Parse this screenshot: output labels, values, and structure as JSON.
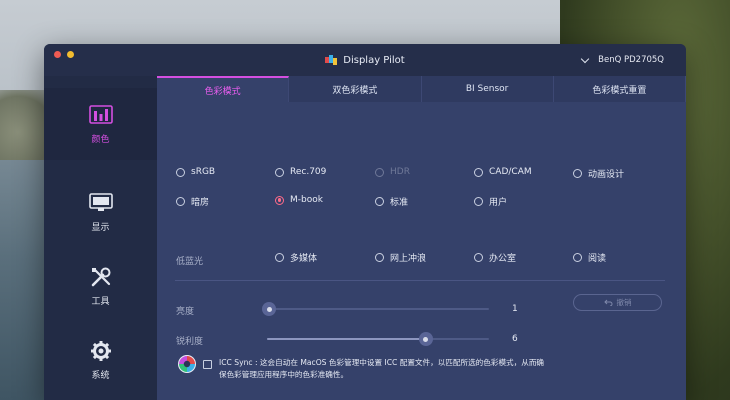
{
  "app": {
    "title": "Display Pilot",
    "monitor": "BenQ PD2705Q"
  },
  "sidebar": {
    "items": [
      {
        "label": "颜色",
        "icon": "color-bars-icon",
        "active": true
      },
      {
        "label": "显示",
        "icon": "monitor-icon",
        "active": false
      },
      {
        "label": "工具",
        "icon": "tools-icon",
        "active": false
      },
      {
        "label": "系统",
        "icon": "gear-icon",
        "active": false
      }
    ]
  },
  "tabs": [
    {
      "label": "色彩模式",
      "active": true
    },
    {
      "label": "双色彩模式",
      "active": false
    },
    {
      "label": "BI Sensor",
      "active": false
    },
    {
      "label": "色彩模式重置",
      "active": false
    }
  ],
  "color_modes": {
    "row1": [
      "sRGB",
      "Rec.709",
      "HDR",
      "CAD/CAM",
      "动画设计"
    ],
    "row2": [
      "暗房",
      "M-book",
      "标准",
      "用户"
    ],
    "selected": "M-book",
    "disabled": [
      "HDR"
    ]
  },
  "low_blue_light": {
    "label": "低蓝光",
    "options": [
      "多媒体",
      "网上冲浪",
      "办公室",
      "阅读"
    ]
  },
  "brightness": {
    "label": "亮度",
    "value": 1,
    "min": 0,
    "max": 100
  },
  "sharpness": {
    "label": "锐利度",
    "value": 6,
    "min": 1,
    "max": 8
  },
  "undo": {
    "label": "撤销"
  },
  "icc_sync": {
    "checked": false,
    "text": "ICC Sync : 这会自动在 MacOS 色彩管理中设置 ICC 配置文件，以匹配所选的色彩模式，从而确保色彩管理应用程序中的色彩准确性。"
  },
  "colors": {
    "accent": "#d44fe0",
    "radio_selected": "#ff6b8a"
  }
}
